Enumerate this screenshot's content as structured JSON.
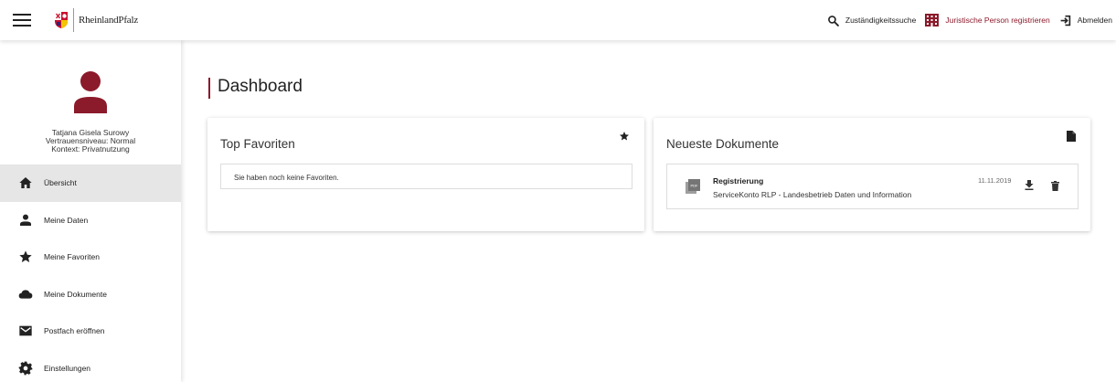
{
  "header": {
    "brand_name": "RheinlandPfalz",
    "nav": {
      "search_label": "Zuständigkeitssuche",
      "register_label": "Juristische Person registrieren",
      "logout_label": "Abmelden"
    }
  },
  "sidebar": {
    "user": {
      "name": "Tatjana Gisela Surowy",
      "trust_level": "Vertrauensniveau: Normal",
      "context": "Kontext: Privatnutzung"
    },
    "items": [
      {
        "label": "Übersicht",
        "icon": "home-icon",
        "active": true
      },
      {
        "label": "Meine Daten",
        "icon": "person-icon",
        "active": false
      },
      {
        "label": "Meine Favoriten",
        "icon": "star-icon",
        "active": false
      },
      {
        "label": "Meine Dokumente",
        "icon": "cloud-icon",
        "active": false
      },
      {
        "label": "Postfach eröffnen",
        "icon": "mail-icon",
        "active": false
      },
      {
        "label": "Einstellungen",
        "icon": "gear-icon",
        "active": false
      }
    ]
  },
  "main": {
    "title": "Dashboard",
    "favorites": {
      "title": "Top Favoriten",
      "empty_text": "Sie haben noch keine Favoriten."
    },
    "documents": {
      "title": "Neueste Dokumente",
      "items": [
        {
          "title": "Registrierung",
          "subtitle": "ServiceKonto RLP - Landesbetrieb Daten und Information",
          "date": "11.11.2019",
          "file_type_icon": "pdf-file-icon"
        }
      ]
    }
  },
  "colors": {
    "accent": "#8b1a2b",
    "active_item_bg": "#e6e6e6",
    "text": "#222222"
  }
}
